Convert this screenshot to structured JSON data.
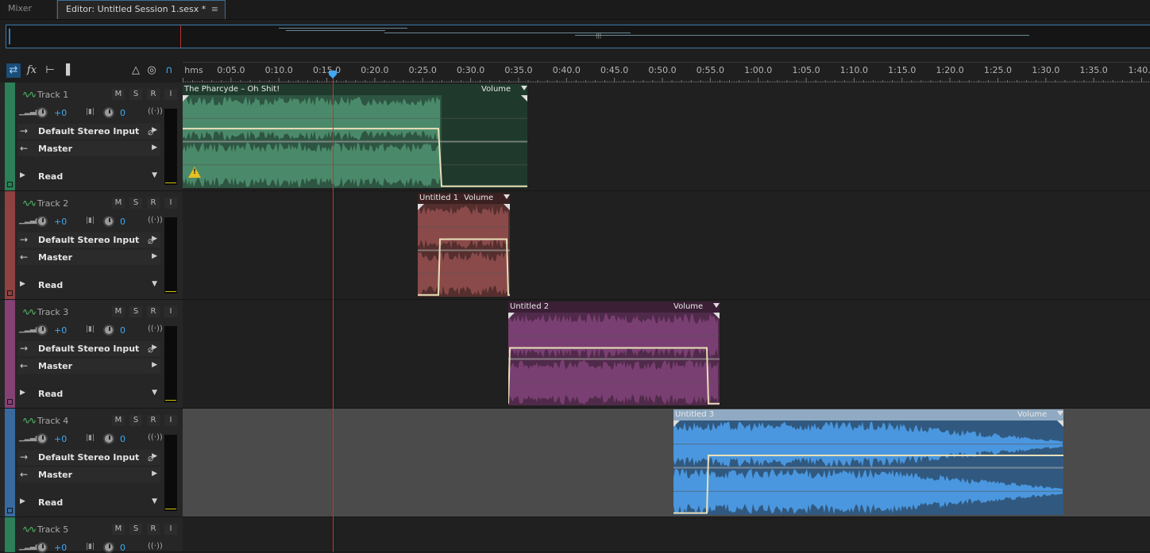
{
  "tabs": {
    "mixer": "Mixer",
    "editor": "Editor: Untitled Session 1.sesx *",
    "editor_menu": "≡"
  },
  "toolbar": {
    "icons": [
      "switch-icon",
      "fx-icon",
      "sends-icon",
      "eq-icon",
      "metronome-icon",
      "input-monitor-icon",
      "headphones-icon"
    ]
  },
  "ruler": {
    "unit": "hms",
    "labels": [
      "0:05.0",
      "0:10.0",
      "0:15.0",
      "0:20.0",
      "0:25.0",
      "0:30.0",
      "0:35.0",
      "0:40.0",
      "0:45.0",
      "0:50.0",
      "0:55.0",
      "1:00.0",
      "1:05.0",
      "1:10.0",
      "1:15.0",
      "1:20.0",
      "1:25.0",
      "1:30.0",
      "1:35.0",
      "1:40."
    ]
  },
  "playhead": {
    "time": "0:15.0"
  },
  "tracks": [
    {
      "name": "Track 1",
      "m": "M",
      "s": "S",
      "r": "R",
      "i": "I",
      "volume": "+0",
      "pan": "0",
      "input": "Default Stereo Input",
      "output": "Master",
      "automation": "Read",
      "color": "#2f9e6a"
    },
    {
      "name": "Track 2",
      "m": "M",
      "s": "S",
      "r": "R",
      "i": "I",
      "volume": "+0",
      "pan": "0",
      "input": "Default Stereo Input",
      "output": "Master",
      "automation": "Read",
      "color": "#b44a4a"
    },
    {
      "name": "Track 3",
      "m": "M",
      "s": "S",
      "r": "R",
      "i": "I",
      "volume": "+0",
      "pan": "0",
      "input": "Default Stereo Input",
      "output": "Master",
      "automation": "Read",
      "color": "#a64a8e"
    },
    {
      "name": "Track 4",
      "m": "M",
      "s": "S",
      "r": "R",
      "i": "I",
      "volume": "+0",
      "pan": "0",
      "input": "Default Stereo Input",
      "output": "Master",
      "automation": "Read",
      "color": "#3f82c8"
    },
    {
      "name": "Track 5",
      "m": "M",
      "s": "S",
      "r": "R",
      "i": "I",
      "volume": "+0",
      "pan": "0",
      "input": "",
      "output": "",
      "automation": "",
      "color": "#2f9e6a"
    }
  ],
  "clips": [
    {
      "title": "The Pharcyde – Oh Shit!",
      "volume_label": "Volume",
      "color": "#4a8a6a",
      "dark": "#1f3a2d",
      "track": 1
    },
    {
      "title": "Untitled 1",
      "volume_label": "Volume",
      "color": "#8a4a4a",
      "dark": "#3a2020",
      "track": 2
    },
    {
      "title": "Untitled 2",
      "volume_label": "Volume",
      "color": "#7a3f72",
      "dark": "#3a1f35",
      "track": 3
    },
    {
      "title": "Untitled 3",
      "volume_label": "Volume",
      "color": "#4a97df",
      "dark": "#24384d",
      "track": 4
    }
  ]
}
